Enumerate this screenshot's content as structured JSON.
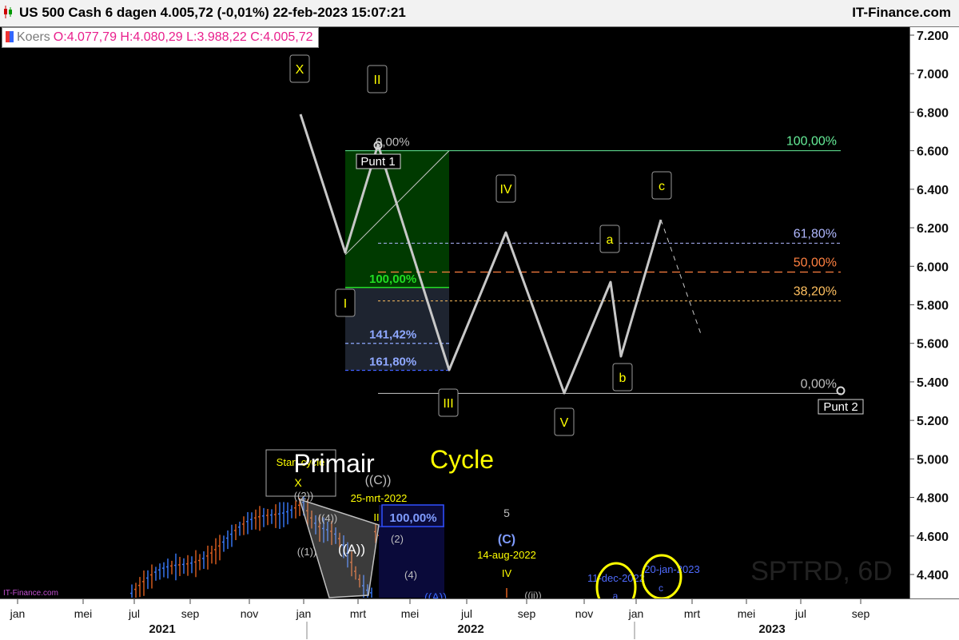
{
  "header": {
    "title": "US 500 Cash 6 dagen 4.005,72 (-0,01%) 22-feb-2023 15:07:21",
    "brand": "IT-Finance.com",
    "legend_name": "Koers",
    "legend_values": "O:4.077,79 H:4.080,29 L:3.988,22 C:4.005,72",
    "legend_color": "#e91e8c",
    "watermark": "IT-Finance.com",
    "symbol_watermark": "SPTRD, 6D"
  },
  "colors": {
    "background": "#000000",
    "projection_line": "#c8c8c8",
    "wave_label": "#ffff00",
    "fib_upper_green": "#66ee99",
    "fib_618": "#b0b8ff",
    "fib_500": "#ff8040",
    "fib_382": "#ffc060",
    "fib_ext_green": "#22dd22",
    "fib_ext_blue": "#8fa8ff",
    "box_green": "#003a00",
    "box_gray": "#1e2430",
    "candle_up": "#3a7cff",
    "candle_down": "#e06020"
  },
  "chart_data": {
    "type": "line",
    "y_axis": {
      "ticks": [
        "7.200",
        "7.000",
        "6.800",
        "6.600",
        "6.400",
        "6.200",
        "6.000",
        "5.800",
        "5.600",
        "5.400",
        "5.200",
        "5.000",
        "4.800",
        "4.600",
        "4.400"
      ],
      "range": [
        4300,
        7260
      ]
    },
    "x_axis": {
      "month_ticks": [
        "jan",
        "mei",
        "jul",
        "sep",
        "nov",
        "jan",
        "mrt",
        "mei",
        "jul",
        "sep",
        "nov",
        "jan",
        "mrt",
        "mei",
        "jul",
        "sep"
      ],
      "year_ticks": [
        "2021",
        "2022",
        "2023"
      ]
    },
    "series": [
      {
        "role": "wave-projection",
        "points": [
          {
            "x": "2021-12",
            "y": 6760
          },
          {
            "x": "2022-02",
            "y": 6060
          },
          {
            "x": "2022-03",
            "y": 6600
          },
          {
            "x": "2022-06",
            "y": 5450
          },
          {
            "x": "2022-09",
            "y": 6150
          },
          {
            "x": "2022-11",
            "y": 5330
          },
          {
            "x": "2023-01",
            "y": 5900
          },
          {
            "x": "2023-01",
            "y": 5520
          },
          {
            "x": "2023-02",
            "y": 6220
          }
        ],
        "dashed_tail": [
          {
            "x": "2023-02",
            "y": 6220
          },
          {
            "x": "2023-03",
            "y": 5640
          }
        ]
      }
    ],
    "wave_labels": [
      "X",
      "II",
      "I",
      "IV",
      "III",
      "V",
      "a",
      "b",
      "c"
    ],
    "fib_retracement": {
      "levels": [
        {
          "label": "100,00%",
          "price": 6600
        },
        {
          "label": "61,80%",
          "price": 6120
        },
        {
          "label": "50,00%",
          "price": 5970
        },
        {
          "label": "38,20%",
          "price": 5820
        },
        {
          "label": "0,00%",
          "price": 5340
        }
      ]
    },
    "fib_extension": {
      "top_label": "0,00%",
      "levels": [
        {
          "label": "100,00%",
          "price": 5890
        },
        {
          "label": "141,42%",
          "price": 5600
        },
        {
          "label": "161,80%",
          "price": 5460
        }
      ]
    },
    "points": {
      "start": "Punt 1",
      "end": "Punt 2"
    },
    "lower_annotations": {
      "primair": "Primair",
      "cycle": "Cycle",
      "start_cycle": "Start cycle",
      "x": "X",
      "wave_2": "((2))",
      "wave_4": "((4))",
      "wave_1": "((1))",
      "wave_A": "((A))",
      "wave_C": "((C))",
      "date_1": "25-mrt-2022",
      "ii": "II",
      "fib_box": "100,00%",
      "w2": "(2)",
      "w4": "(4)",
      "wA": "((A))",
      "five": "5",
      "wC": "(C)",
      "date_2": "14-aug-2022",
      "iv": "IV",
      "wii": "((ii))",
      "date_3": "11-dec-2022",
      "date_4": "20-jan-2023",
      "small_a": "a",
      "small_c": "c"
    }
  }
}
